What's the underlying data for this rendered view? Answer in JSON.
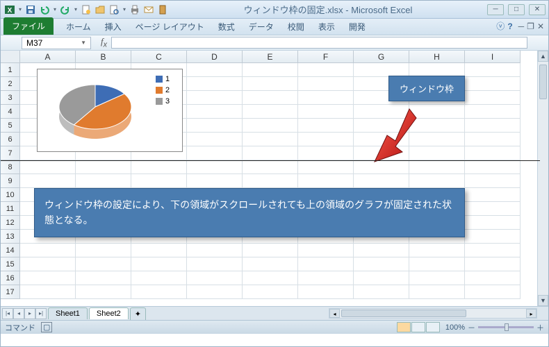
{
  "title": "ウィンドウ枠の固定.xlsx - Microsoft Excel",
  "file_tab": "ファイル",
  "tabs": [
    "ホーム",
    "挿入",
    "ページ レイアウト",
    "数式",
    "データ",
    "校閲",
    "表示",
    "開発"
  ],
  "namebox": "M37",
  "columns": [
    "A",
    "B",
    "C",
    "D",
    "E",
    "F",
    "G",
    "H",
    "I"
  ],
  "rows": [
    "1",
    "2",
    "3",
    "4",
    "5",
    "6",
    "7",
    "8",
    "9",
    "10",
    "11",
    "12",
    "13",
    "14",
    "15",
    "16",
    "17"
  ],
  "chart_data": {
    "type": "pie",
    "categories": [
      "1",
      "2",
      "3"
    ],
    "values": [
      15,
      45,
      40
    ],
    "colors": [
      "#3e6db5",
      "#e07b2e",
      "#9a9a9a"
    ],
    "title": ""
  },
  "callout1": "ウィンドウ枠",
  "callout2": "ウィンドウ枠の設定により、下の領域がスクロールされても上の領域のグラフが固定された状態となる。",
  "sheets": [
    "Sheet1",
    "Sheet2"
  ],
  "active_sheet": 1,
  "status": "コマンド",
  "zoom": "100%",
  "zoom_minus": "－",
  "zoom_plus": "＋"
}
